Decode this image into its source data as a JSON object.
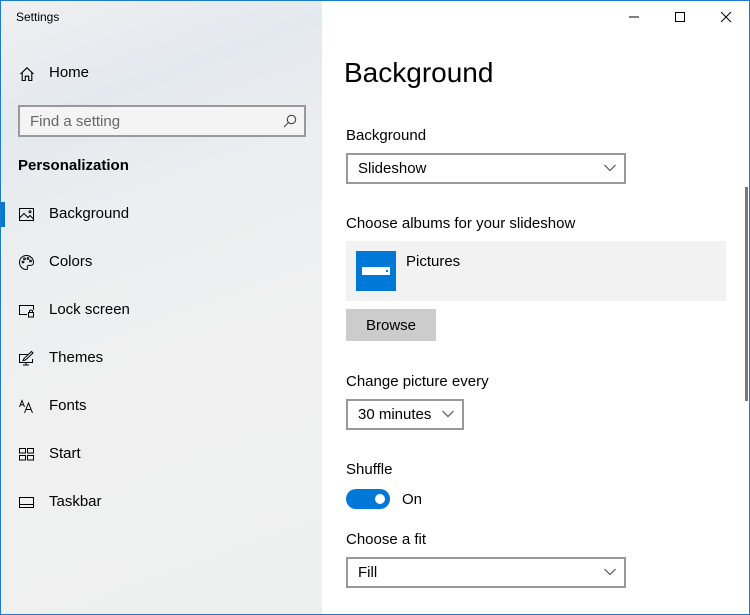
{
  "window": {
    "title": "Settings",
    "controls": {
      "minimize": "minimize-icon",
      "maximize": "maximize-icon",
      "close": "close-icon"
    },
    "accent_color": "#0078d7",
    "border_color": "#1a7bd0"
  },
  "sidebar": {
    "home": {
      "label": "Home",
      "icon": "home-icon"
    },
    "search": {
      "placeholder": "Find a setting",
      "value": "",
      "icon": "search-icon"
    },
    "section_heading": "Personalization",
    "items": [
      {
        "label": "Background",
        "icon": "picture-icon",
        "active": true
      },
      {
        "label": "Colors",
        "icon": "palette-icon",
        "active": false
      },
      {
        "label": "Lock screen",
        "icon": "lock-screen-icon",
        "active": false
      },
      {
        "label": "Themes",
        "icon": "themes-icon",
        "active": false
      },
      {
        "label": "Fonts",
        "icon": "fonts-icon",
        "active": false
      },
      {
        "label": "Start",
        "icon": "start-icon",
        "active": false
      },
      {
        "label": "Taskbar",
        "icon": "taskbar-icon",
        "active": false
      }
    ]
  },
  "main": {
    "title": "Background",
    "background": {
      "label": "Background",
      "selected": "Slideshow"
    },
    "albums": {
      "label": "Choose albums for your slideshow",
      "items": [
        {
          "name": "Pictures",
          "icon": "folder-tile-icon"
        }
      ],
      "browse_label": "Browse"
    },
    "interval": {
      "label": "Change picture every",
      "selected": "30 minutes"
    },
    "shuffle": {
      "label": "Shuffle",
      "on": true,
      "state_label": "On"
    },
    "fit": {
      "label": "Choose a fit",
      "selected": "Fill"
    }
  }
}
